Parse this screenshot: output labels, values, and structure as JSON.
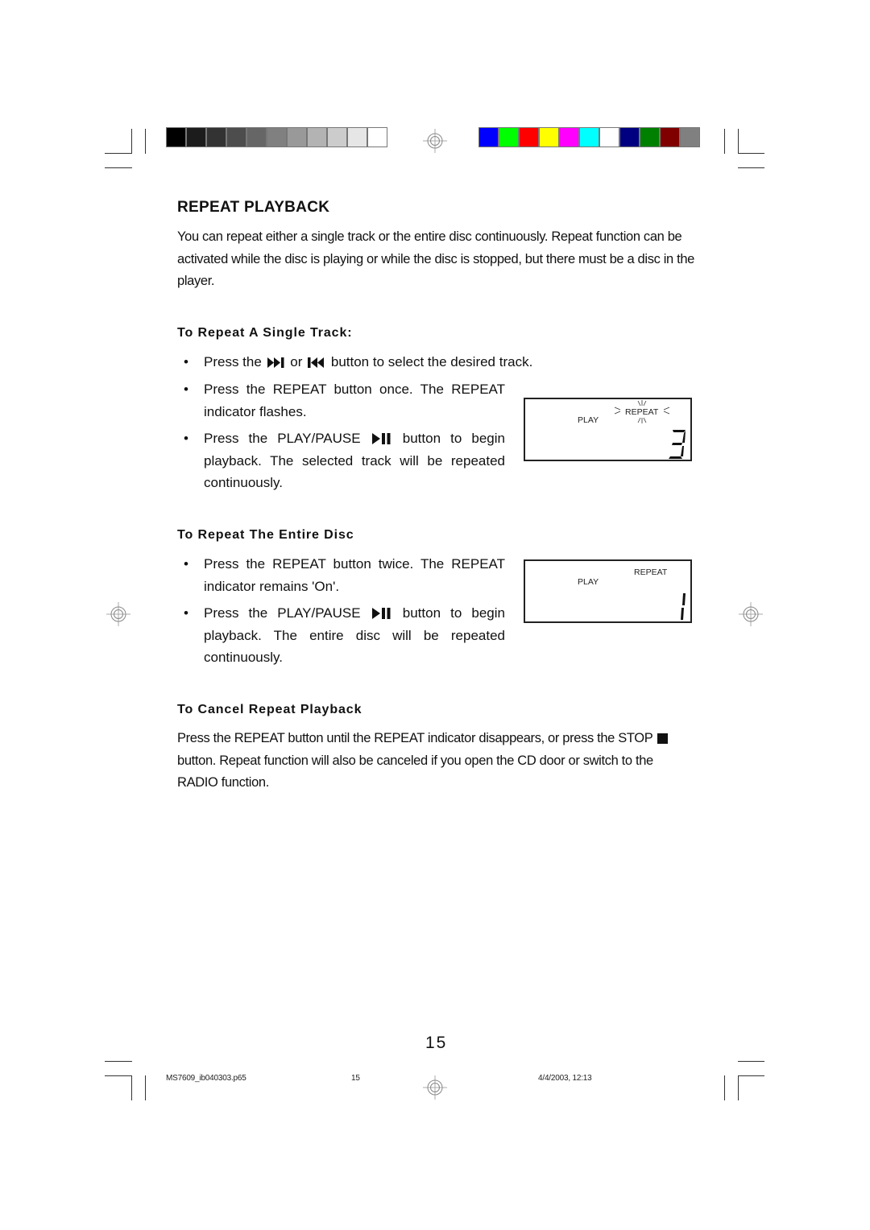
{
  "registration": {
    "grayscale_swatches": [
      "#000000",
      "#1c1c1c",
      "#333333",
      "#4d4d4d",
      "#666666",
      "#808080",
      "#999999",
      "#b3b3b3",
      "#cccccc",
      "#e6e6e6",
      "#ffffff"
    ],
    "color_swatches": [
      "#0000ff",
      "#00ff00",
      "#ff0000",
      "#ffff00",
      "#ff00ff",
      "#00ffff",
      "#ffffff",
      "#000080",
      "#008000",
      "#800000",
      "#808080"
    ]
  },
  "page": {
    "title": "REPEAT PLAYBACK",
    "intro": "You can repeat either a single track or the entire disc continuously. Repeat function can be activated while the disc is playing or while the disc is stopped, but there must be a disc in the player.",
    "single_track": {
      "heading": "To Repeat A Single Track:",
      "bullets": [
        {
          "pre": "Press the",
          "icon1": "skip-forward-icon",
          "mid": "or",
          "icon2": "skip-back-icon",
          "post": "button to select the desired track."
        },
        {
          "text": "Press the REPEAT button once. The REPEAT indicator flashes."
        },
        {
          "pre": "Press the PLAY/PAUSE",
          "icon": "play-pause-icon",
          "post": "button to begin playback. The selected track will be repeated continuously."
        }
      ],
      "lcd": {
        "play_label": "PLAY",
        "repeat_label": "REPEAT",
        "repeat_state": "flashing",
        "digit": "3"
      }
    },
    "entire_disc": {
      "heading": "To Repeat The Entire Disc",
      "bullets": [
        {
          "text": "Press the REPEAT button twice. The REPEAT indicator remains 'On'."
        },
        {
          "pre": "Press the PLAY/PAUSE",
          "icon": "play-pause-icon",
          "post": "button to begin playback. The entire disc will be repeated continuously."
        }
      ],
      "lcd": {
        "play_label": "PLAY",
        "repeat_label": "REPEAT",
        "repeat_state": "on",
        "digit": "1"
      }
    },
    "cancel": {
      "heading": "To Cancel Repeat Playback",
      "pre": "Press the REPEAT button until the REPEAT indicator disappears, or press the STOP",
      "icon": "stop-icon",
      "post": "button. Repeat function will also be canceled if you open the CD door or switch to the RADIO function."
    },
    "page_number": "15"
  },
  "footer": {
    "filename": "MS7609_ib040303.p65",
    "page": "15",
    "datetime": "4/4/2003, 12:13"
  }
}
